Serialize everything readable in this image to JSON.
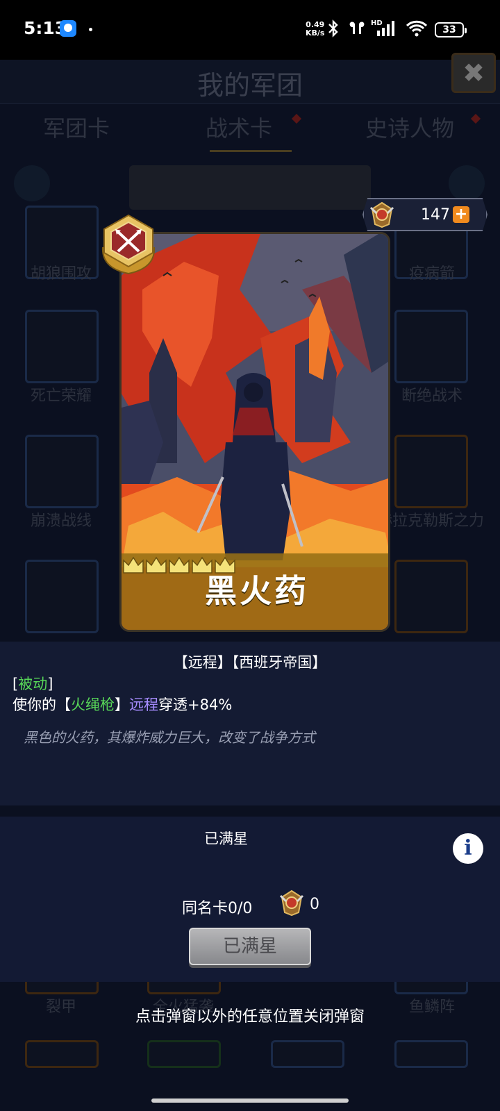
{
  "status_bar": {
    "time": "5:13",
    "net_speed_value": "0.49",
    "net_speed_unit": "KB/s",
    "battery": "33",
    "network": "HD"
  },
  "background": {
    "title": "我的军团",
    "tabs": [
      "军团卡",
      "战术卡",
      "史诗人物"
    ],
    "active_tab": "战术卡",
    "card_labels": [
      "胡狼围攻",
      "疫病箭",
      "死亡荣耀",
      "断绝战术",
      "崩溃战线",
      "赫拉克勒斯之力",
      "裂甲",
      "全火猛袭",
      "鱼鳞阵"
    ]
  },
  "currency": {
    "amount": "147",
    "plus": "+"
  },
  "card": {
    "name": "黑火药",
    "stars": 5
  },
  "info": {
    "tags": "【远程】【西班牙帝国】",
    "type_open": "[",
    "type": "被动",
    "type_close": "]",
    "line_prefix": "使你的【",
    "unit": "火绳枪",
    "bracket_close": "】",
    "ranged": "远程",
    "effect": "穿透+84%",
    "flavor": "黑色的火药，其爆炸威力巨大，改变了战争方式"
  },
  "star_panel": {
    "status": "已满星",
    "info_icon": "i",
    "dup_label": "同名卡0/0",
    "dup_count": "0",
    "button": "已满星"
  },
  "close_hint": "点击弹窗以外的任意位置关闭弹窗",
  "colors": {
    "accent_gold": "#d4a83a",
    "skill_green": "#58d858",
    "skill_purple": "#a68cff",
    "plus_orange": "#f08a1e"
  }
}
